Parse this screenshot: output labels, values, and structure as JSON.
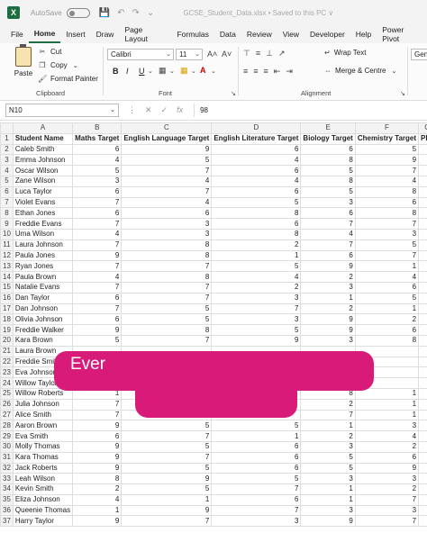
{
  "titlebar": {
    "autosave_label": "AutoSave",
    "autosave_state": "Off",
    "document_title": "GCSE_Student_Data.xlsx • Saved to this PC ∨"
  },
  "tabs": [
    "File",
    "Home",
    "Insert",
    "Draw",
    "Page Layout",
    "Formulas",
    "Data",
    "Review",
    "View",
    "Developer",
    "Help",
    "Power Pivot"
  ],
  "active_tab": "Home",
  "ribbon": {
    "paste_label": "Paste",
    "cut_label": "Cut",
    "copy_label": "Copy",
    "format_painter_label": "Format Painter",
    "clipboard_group": "Clipboard",
    "font_name": "Calibri",
    "font_size": "11",
    "font_group": "Font",
    "bold": "B",
    "italic": "I",
    "underline": "U",
    "wrap_text_label": "Wrap Text",
    "merge_center_label": "Merge & Centre",
    "alignment_group": "Alignment",
    "number_format": "Gene"
  },
  "formula_bar": {
    "name_box": "N10",
    "value": "98"
  },
  "columns": [
    "A",
    "B",
    "C",
    "D",
    "E",
    "F",
    "G"
  ],
  "headers": [
    "Student Name",
    "Maths Target",
    "English Language Target",
    "English Literature Target",
    "Biology Target",
    "Chemistry Target",
    "Phy"
  ],
  "rows": [
    [
      "Caleb Smith",
      "6",
      "9",
      "6",
      "6",
      "5"
    ],
    [
      "Emma Johnson",
      "4",
      "5",
      "4",
      "8",
      "9"
    ],
    [
      "Oscar Wilson",
      "5",
      "7",
      "6",
      "5",
      "7"
    ],
    [
      "Zane Wilson",
      "3",
      "4",
      "4",
      "8",
      "4"
    ],
    [
      "Luca Taylor",
      "6",
      "7",
      "6",
      "5",
      "8"
    ],
    [
      "Violet Evans",
      "7",
      "4",
      "5",
      "3",
      "6"
    ],
    [
      "Ethan Jones",
      "6",
      "6",
      "8",
      "6",
      "8"
    ],
    [
      "Freddie Evans",
      "7",
      "3",
      "6",
      "7",
      "7"
    ],
    [
      "Uma Wilson",
      "4",
      "3",
      "8",
      "4",
      "3"
    ],
    [
      "Laura Johnson",
      "7",
      "8",
      "2",
      "7",
      "5"
    ],
    [
      "Paula Jones",
      "9",
      "8",
      "1",
      "6",
      "7"
    ],
    [
      "Ryan Jones",
      "7",
      "7",
      "5",
      "9",
      "1"
    ],
    [
      "Paula Brown",
      "4",
      "8",
      "4",
      "2",
      "4"
    ],
    [
      "Natalie Evans",
      "7",
      "7",
      "2",
      "3",
      "6"
    ],
    [
      "Dan Taylor",
      "6",
      "7",
      "3",
      "1",
      "5"
    ],
    [
      "Dan Johnson",
      "7",
      "5",
      "7",
      "2",
      "1"
    ],
    [
      "Olivia Johnson",
      "6",
      "5",
      "3",
      "9",
      "2"
    ],
    [
      "Freddie Walker",
      "9",
      "8",
      "5",
      "9",
      "6"
    ],
    [
      "Kara Brown",
      "5",
      "7",
      "9",
      "3",
      "8"
    ],
    [
      "Laura Brown",
      "",
      "",
      "",
      "",
      ""
    ],
    [
      "Freddie Smith",
      "",
      "",
      "",
      "",
      ""
    ],
    [
      "Eva Johnson",
      "",
      "",
      "",
      "",
      ""
    ],
    [
      "Willow Taylor",
      "",
      "",
      "",
      "",
      ""
    ],
    [
      "Willow Roberts",
      "1",
      "",
      "",
      "8",
      "1"
    ],
    [
      "Julia Johnson",
      "7",
      "",
      "",
      "2",
      "1"
    ],
    [
      "Alice Smith",
      "7",
      "",
      "",
      "7",
      "1"
    ],
    [
      "Aaron Brown",
      "9",
      "5",
      "5",
      "1",
      "3"
    ],
    [
      "Eva Smith",
      "6",
      "7",
      "1",
      "2",
      "4"
    ],
    [
      "Molly Thomas",
      "9",
      "5",
      "6",
      "3",
      "2"
    ],
    [
      "Kara Thomas",
      "9",
      "7",
      "6",
      "5",
      "6"
    ],
    [
      "Jack Roberts",
      "9",
      "5",
      "6",
      "5",
      "9"
    ],
    [
      "Leah Wilson",
      "8",
      "9",
      "5",
      "3",
      "3"
    ],
    [
      "Kevin Smith",
      "2",
      "5",
      "7",
      "1",
      "2"
    ],
    [
      "Eliza Johnson",
      "4",
      "1",
      "6",
      "1",
      "7"
    ],
    [
      "Queenie Thomas",
      "1",
      "9",
      "7",
      "3",
      "3"
    ],
    [
      "Harry Taylor",
      "9",
      "7",
      "3",
      "9",
      "7"
    ]
  ],
  "overlay": {
    "text": "Ever",
    "color": "#d81a78"
  },
  "colors": {
    "accent": "#1d6f42"
  }
}
